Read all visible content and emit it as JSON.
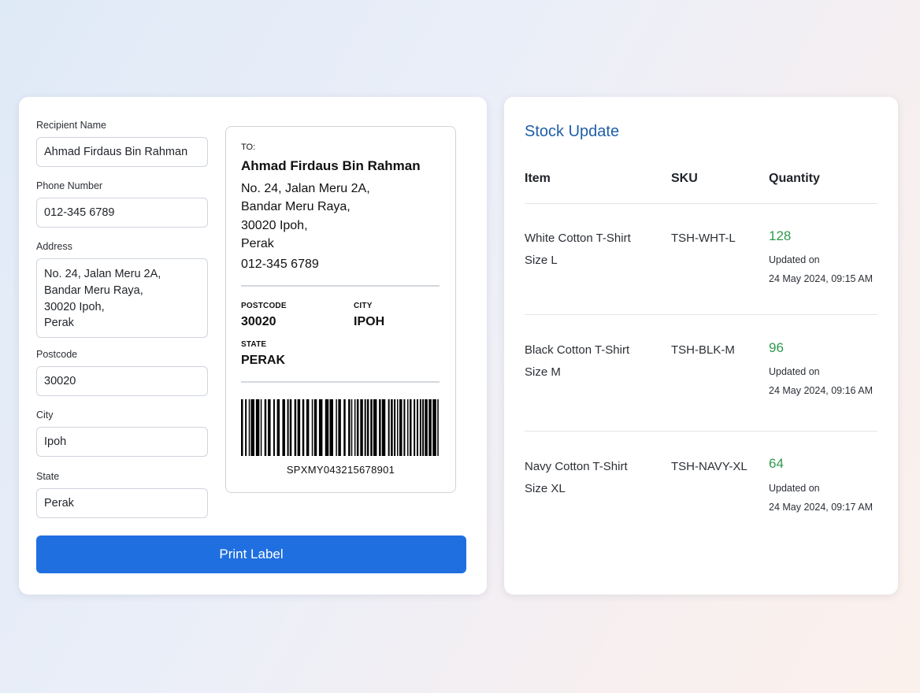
{
  "form": {
    "recipient_label": "Recipient Name",
    "recipient_value": "Ahmad Firdaus Bin Rahman",
    "phone_label": "Phone Number",
    "phone_value": "012-345 6789",
    "address_label": "Address",
    "address_value": "No. 24, Jalan Meru 2A,\nBandar Meru Raya,\n30020 Ipoh,\nPerak",
    "postcode_label": "Postcode",
    "postcode_value": "30020",
    "city_label": "City",
    "city_value": "Ipoh",
    "state_label": "State",
    "state_value": "Perak",
    "print_button": "Print Label"
  },
  "label": {
    "to": "TO:",
    "name": "Ahmad Firdaus Bin Rahman",
    "address": "No. 24, Jalan Meru 2A,\nBandar Meru Raya,\n30020 Ipoh,\nPerak",
    "phone": "012-345 6789",
    "postcode_caption": "POSTCODE",
    "postcode": "30020",
    "city_caption": "CITY",
    "city": "IPOH",
    "state_caption": "STATE",
    "state": "PERAK",
    "tracking": "SPXMY043215678901"
  },
  "stock": {
    "title": "Stock Update",
    "columns": [
      "Item",
      "SKU",
      "Quantity"
    ],
    "rows": [
      {
        "item": "White Cotton T-Shirt\nSize L",
        "sku": "TSH-WHT-L",
        "quantity": "128",
        "updated": "Updated on\n24 May 2024, 09:15 AM"
      },
      {
        "item": "Black Cotton T-Shirt\nSize M",
        "sku": "TSH-BLK-M",
        "quantity": "96",
        "updated": "Updated on\n24 May 2024, 09:16 AM"
      },
      {
        "item": "Navy Cotton T-Shirt\nSize XL",
        "sku": "TSH-NAVY-XL",
        "quantity": "64",
        "updated": "Updated on\n24 May 2024, 09:17 AM"
      }
    ]
  },
  "colors": {
    "primary_button": "#1f6fe0",
    "title_blue": "#1e5fa8",
    "quantity_green": "#2e9a4c"
  }
}
